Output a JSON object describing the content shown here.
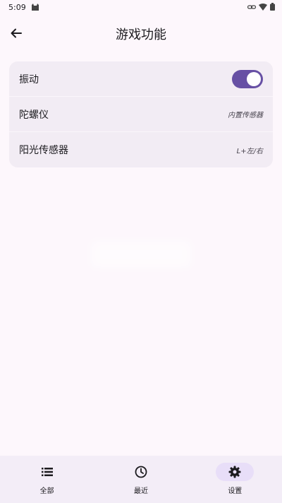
{
  "status_bar": {
    "time": "5:09"
  },
  "top_bar": {
    "title": "游戏功能",
    "back_icon": "arrow-left-icon"
  },
  "settings": [
    {
      "label": "振动",
      "control": "toggle",
      "toggle_on": true
    },
    {
      "label": "陀螺仪",
      "value": "内置传感器"
    },
    {
      "label": "阳光传感器",
      "value": "L+左/右"
    }
  ],
  "bottom_nav": {
    "items": [
      {
        "label": "全部",
        "icon": "list-icon",
        "active": false
      },
      {
        "label": "最近",
        "icon": "clock-icon",
        "active": false
      },
      {
        "label": "设置",
        "icon": "gear-icon",
        "active": true
      }
    ]
  },
  "colors": {
    "background": "#FDF7FC",
    "card": "#F2ECF4",
    "accent": "#6750A4",
    "nav_background": "#F3EDF7",
    "nav_active_indicator": "#E8DEF8"
  }
}
